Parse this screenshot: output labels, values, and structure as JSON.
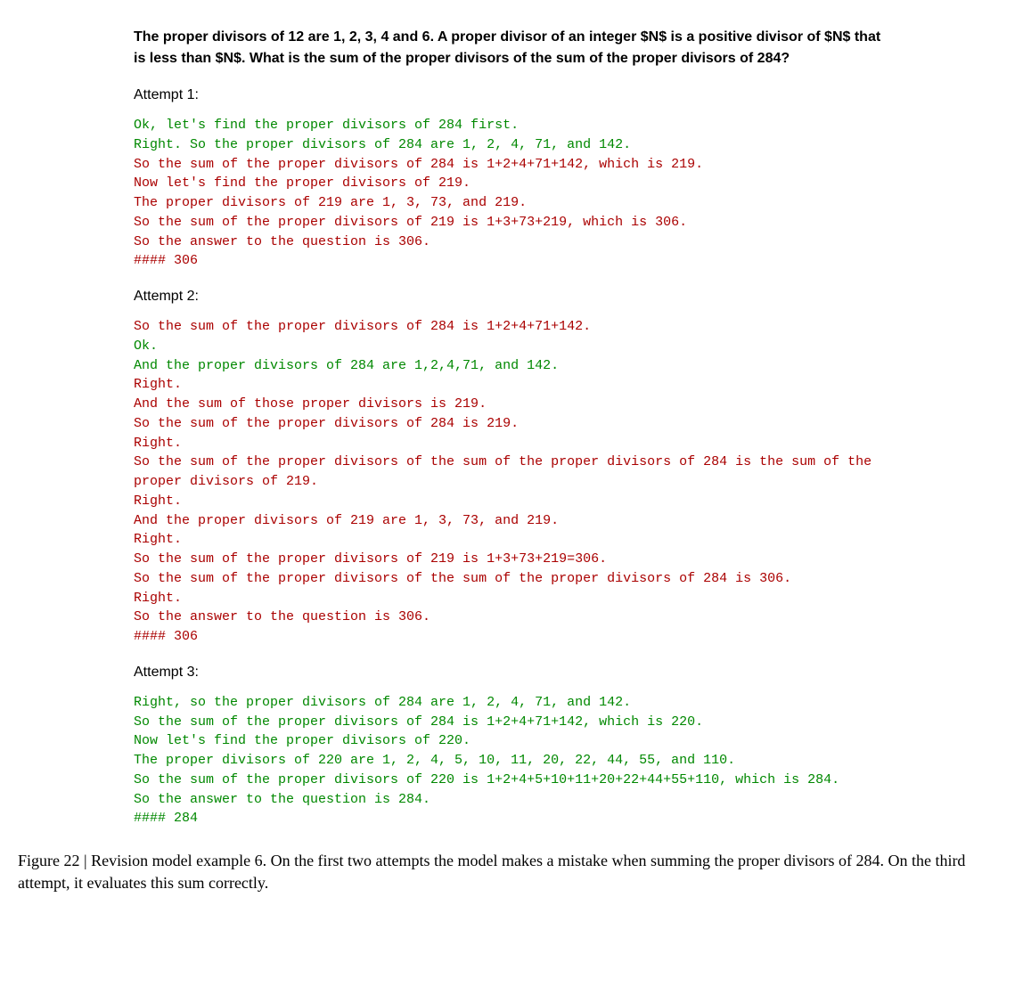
{
  "question": "The proper divisors of 12 are 1, 2, 3, 4 and 6. A proper divisor of an integer $N$ is a positive divisor of $N$ that is less than $N$. What is the sum of the proper divisors of the sum of the proper divisors of 284?",
  "attempts": [
    {
      "label": "Attempt 1:",
      "lines": [
        {
          "class": "green",
          "text": "Ok, let's find the proper divisors of 284 first."
        },
        {
          "class": "green",
          "text": "Right. So the proper divisors of 284 are 1, 2, 4, 71, and 142."
        },
        {
          "class": "red",
          "text": "So the sum of the proper divisors of 284 is 1+2+4+71+142, which is 219."
        },
        {
          "class": "red",
          "text": "Now let's find the proper divisors of 219."
        },
        {
          "class": "red",
          "text": "The proper divisors of 219 are 1, 3, 73, and 219."
        },
        {
          "class": "red",
          "text": "So the sum of the proper divisors of 219 is 1+3+73+219, which is 306."
        },
        {
          "class": "red",
          "text": "So the answer to the question is 306."
        },
        {
          "class": "red",
          "text": "#### 306"
        }
      ]
    },
    {
      "label": "Attempt 2:",
      "lines": [
        {
          "class": "red",
          "text": "So the sum of the proper divisors of 284 is 1+2+4+71+142."
        },
        {
          "class": "green",
          "text": "Ok."
        },
        {
          "class": "green",
          "text": "And the proper divisors of 284 are 1,2,4,71, and 142."
        },
        {
          "class": "red",
          "text": "Right."
        },
        {
          "class": "red",
          "text": "And the sum of those proper divisors is 219."
        },
        {
          "class": "red",
          "text": "So the sum of the proper divisors of 284 is 219."
        },
        {
          "class": "red",
          "text": "Right."
        },
        {
          "class": "red",
          "text": "So the sum of the proper divisors of the sum of the proper divisors of 284 is the sum of the proper divisors of 219."
        },
        {
          "class": "red",
          "text": "Right."
        },
        {
          "class": "red",
          "text": "And the proper divisors of 219 are 1, 3, 73, and 219."
        },
        {
          "class": "red",
          "text": "Right."
        },
        {
          "class": "red",
          "text": "So the sum of the proper divisors of 219 is 1+3+73+219=306."
        },
        {
          "class": "red",
          "text": "So the sum of the proper divisors of the sum of the proper divisors of 284 is 306."
        },
        {
          "class": "red",
          "text": "Right."
        },
        {
          "class": "red",
          "text": "So the answer to the question is 306."
        },
        {
          "class": "red",
          "text": "#### 306"
        }
      ]
    },
    {
      "label": "Attempt 3:",
      "lines": [
        {
          "class": "green",
          "text": "Right, so the proper divisors of 284 are 1, 2, 4, 71, and 142."
        },
        {
          "class": "green",
          "text": "So the sum of the proper divisors of 284 is 1+2+4+71+142, which is 220."
        },
        {
          "class": "green",
          "text": "Now let's find the proper divisors of 220."
        },
        {
          "class": "green",
          "text": "The proper divisors of 220 are 1, 2, 4, 5, 10, 11, 20, 22, 44, 55, and 110."
        },
        {
          "class": "green",
          "text": "So the sum of the proper divisors of 220 is 1+2+4+5+10+11+20+22+44+55+110, which is 284."
        },
        {
          "class": "green",
          "text": "So the answer to the question is 284."
        },
        {
          "class": "green",
          "text": "#### 284"
        }
      ]
    }
  ],
  "caption_label": "Figure 22 | ",
  "caption_text": "Revision model example 6. On the first two attempts the model makes a mistake when summing the proper divisors of 284. On the third attempt, it evaluates this sum correctly."
}
